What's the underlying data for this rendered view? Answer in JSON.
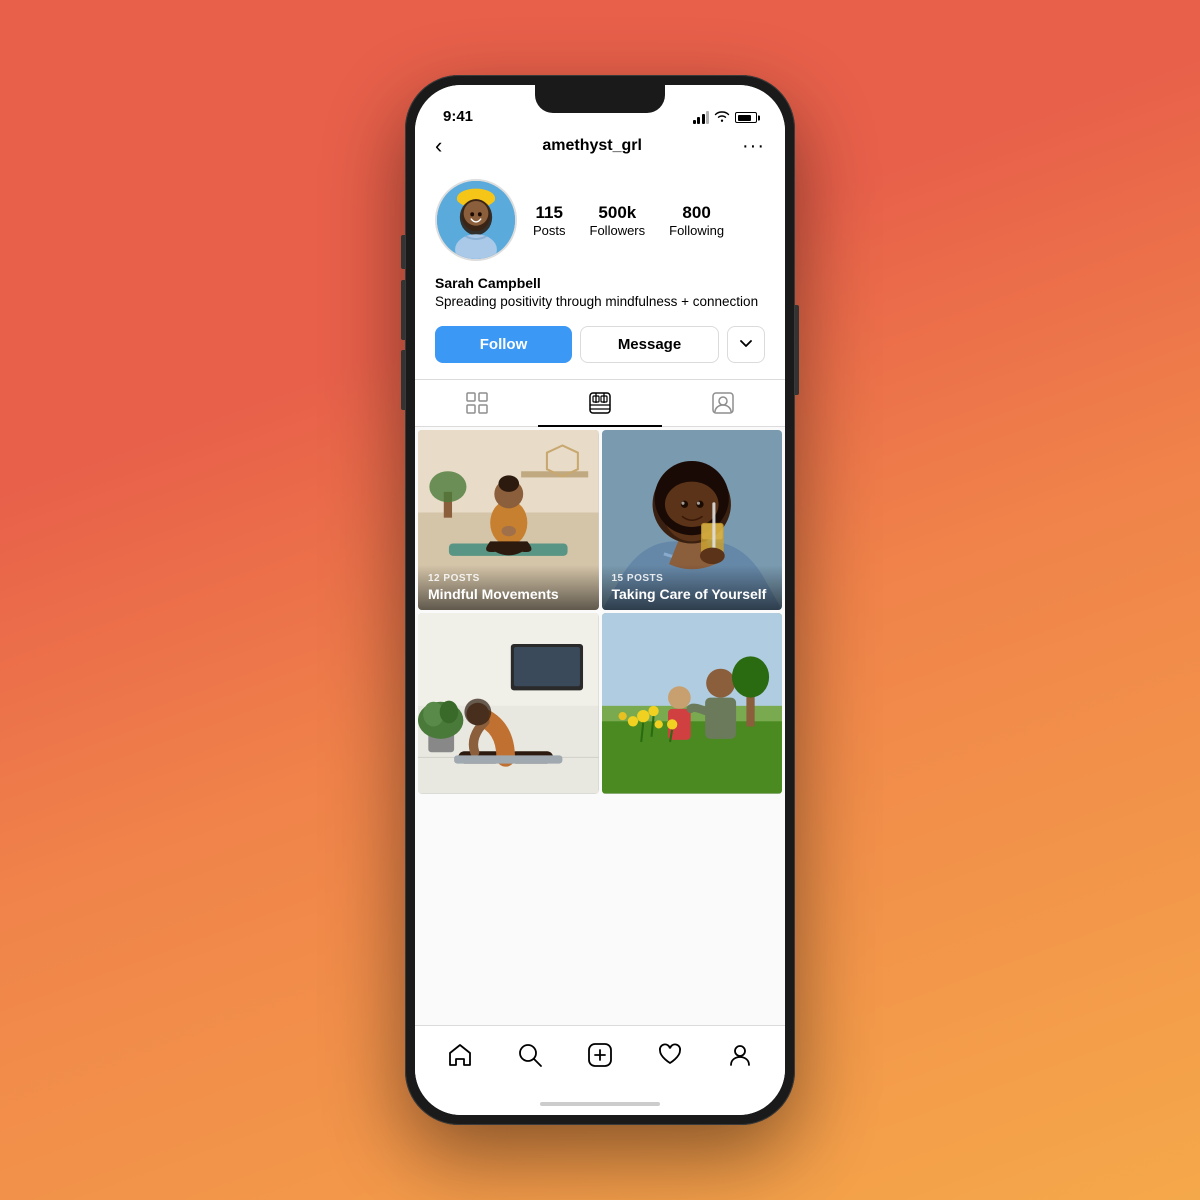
{
  "phone": {
    "status": {
      "time": "9:41"
    },
    "header": {
      "back_label": "‹",
      "username": "amethyst_grl",
      "more_label": "···"
    },
    "profile": {
      "stats": {
        "posts_count": "115",
        "posts_label": "Posts",
        "followers_count": "500k",
        "followers_label": "Followers",
        "following_count": "800",
        "following_label": "Following"
      },
      "bio_name": "Sarah Campbell",
      "bio_text": "Spreading positivity through mindfulness + connection"
    },
    "actions": {
      "follow_label": "Follow",
      "message_label": "Message",
      "dropdown_label": "▾"
    },
    "tabs": {
      "grid_label": "⊞",
      "reels_label": "▤",
      "tagged_label": "☺"
    },
    "grid_items": [
      {
        "posts_count": "12 POSTS",
        "title": "Mindful Movements",
        "has_overlay": true
      },
      {
        "posts_count": "15 POSTS",
        "title": "Taking Care of Yourself",
        "has_overlay": true
      },
      {
        "posts_count": "",
        "title": "",
        "has_overlay": false
      },
      {
        "posts_count": "",
        "title": "",
        "has_overlay": false
      }
    ],
    "bottom_nav": {
      "home_label": "⌂",
      "search_label": "⊙",
      "create_label": "⊕",
      "heart_label": "♡",
      "profile_label": "⊙"
    }
  }
}
